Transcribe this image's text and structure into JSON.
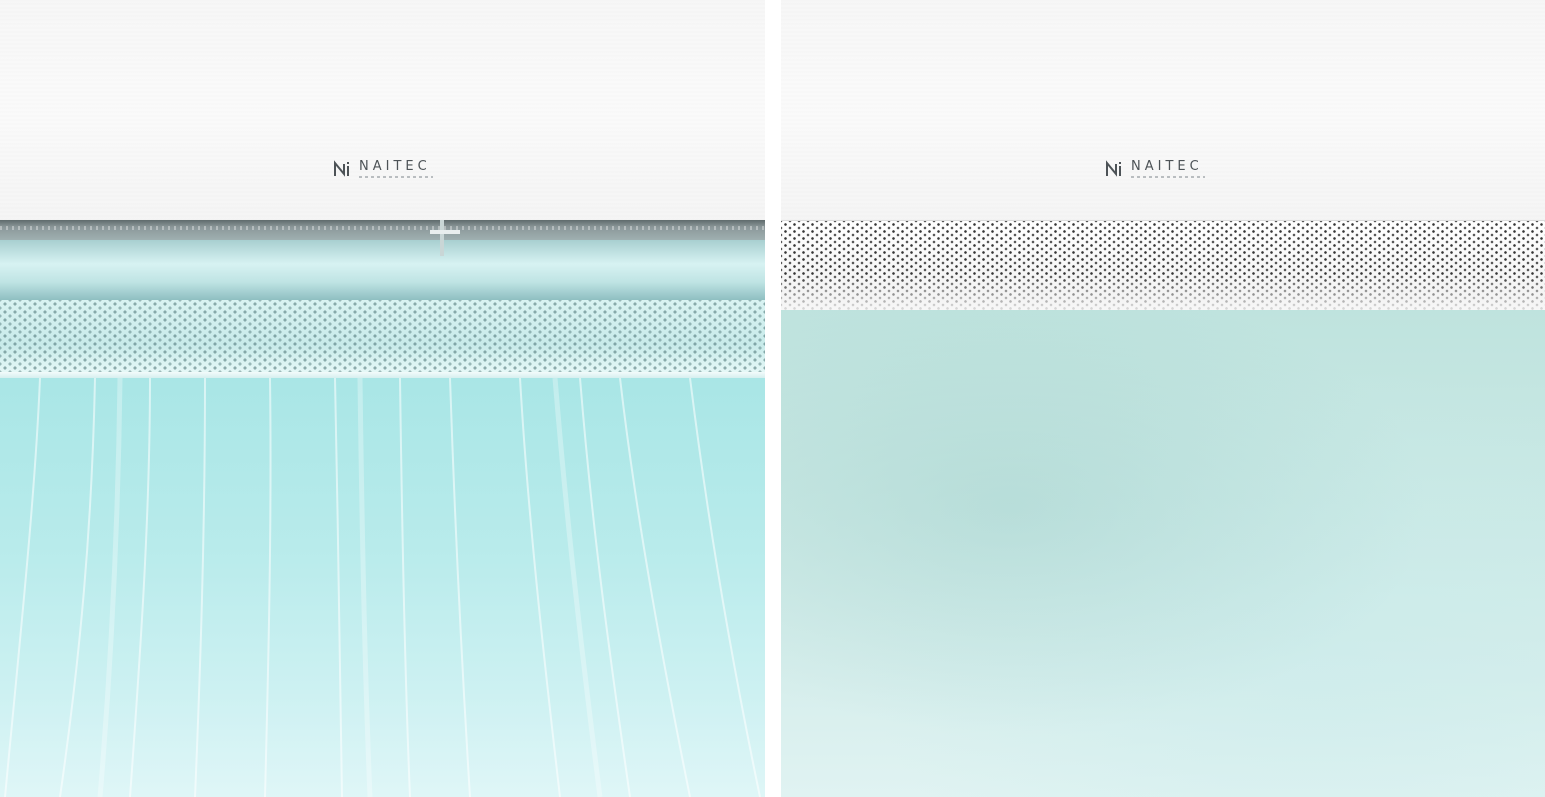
{
  "panels": [
    {
      "id": "left",
      "state": "louver open, airflow",
      "brand": "NAITEC",
      "colors": {
        "body": "#f7f7f7",
        "air": "#b8ebeb"
      }
    },
    {
      "id": "right",
      "state": "louver closed, perforated",
      "brand": "NAITEC",
      "colors": {
        "body": "#f7f7f7",
        "wall": "#cae9e5"
      }
    }
  ]
}
